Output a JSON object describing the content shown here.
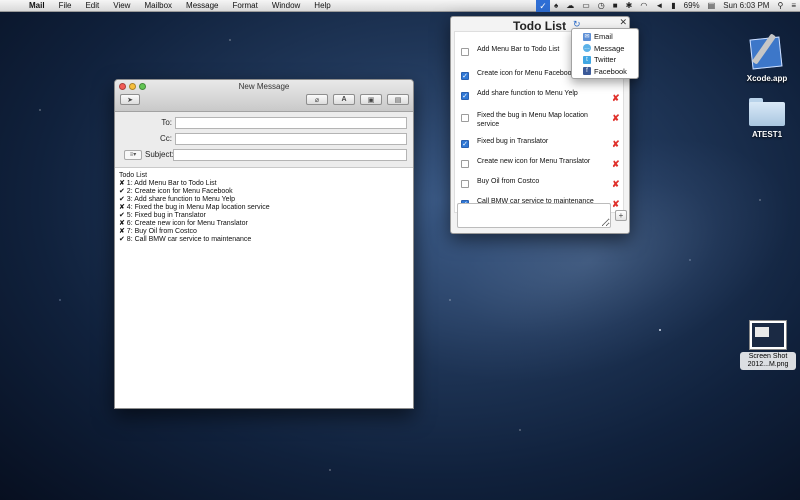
{
  "menubar": {
    "app": "Mail",
    "items": [
      "File",
      "Edit",
      "View",
      "Mailbox",
      "Message",
      "Format",
      "Window",
      "Help"
    ],
    "battery": "69%",
    "clock": "Sun 6:03 PM"
  },
  "desktop": {
    "icons": [
      {
        "label": "Xcode.app",
        "icon": "xcode-icon"
      },
      {
        "label": "ATEST1",
        "icon": "folder-icon"
      },
      {
        "label_line1": "Screen Shot",
        "label_line2": "2012...M.png",
        "icon": "screenshot-file-icon"
      }
    ]
  },
  "mail": {
    "title": "New Message",
    "fields": {
      "to_label": "To:",
      "cc_label": "Cc:",
      "subject_label": "Subject:",
      "to_value": "",
      "cc_value": "",
      "subject_value": ""
    },
    "body": [
      "Todo List",
      "✘ 1: Add Menu Bar to Todo List",
      "✔ 2: Create icon for Menu Facebook",
      "✔ 3: Add share function to Menu Yelp",
      "✘ 4: Fixed the bug in Menu Map location service",
      "✔ 5: Fixed bug in Translator",
      "✘ 6: Create new icon for Menu Translator",
      "✘ 7: Buy Oil from Costco",
      "✔ 8: Call BMW car service to maintenance"
    ]
  },
  "todo": {
    "title": "Todo List",
    "items": [
      {
        "text": "Add Menu Bar to Todo List",
        "checked": false
      },
      {
        "text": "Create icon for Menu Facebook",
        "checked": true
      },
      {
        "text": "Add share function to Menu Yelp",
        "checked": true
      },
      {
        "text": "Fixed the bug in Menu Map location service",
        "checked": false
      },
      {
        "text": "Fixed bug in Translator",
        "checked": true
      },
      {
        "text": "Create new icon for Menu Translator",
        "checked": false
      },
      {
        "text": "Buy Oil from Costco",
        "checked": false
      },
      {
        "text": "Call BMW car service to maintenance",
        "checked": true
      }
    ],
    "add_button": "+",
    "close": "✕",
    "refresh": "↻"
  },
  "share_menu": {
    "items": [
      {
        "label": "Email",
        "icon": "email-icon"
      },
      {
        "label": "Message",
        "icon": "message-icon"
      },
      {
        "label": "Twitter",
        "icon": "twitter-icon"
      },
      {
        "label": "Facebook",
        "icon": "facebook-icon"
      }
    ]
  },
  "colors": {
    "accent": "#2f78d6",
    "delete": "#e0322c"
  }
}
